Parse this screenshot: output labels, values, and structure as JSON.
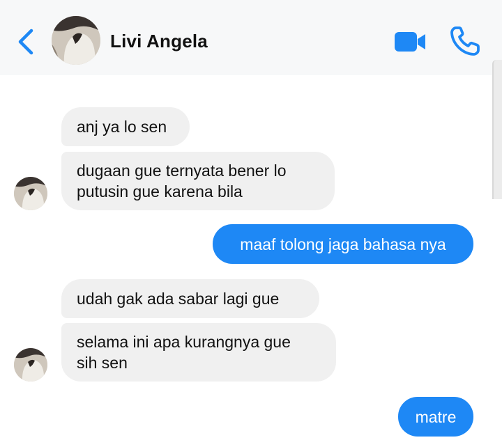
{
  "header": {
    "contact_name": "Livi Angela",
    "back_icon": "chevron-left-icon",
    "video_icon": "video-camera-icon",
    "call_icon": "phone-icon",
    "accent_color": "#1e88f5"
  },
  "messages": [
    {
      "from": "contact",
      "text": "anj ya lo sen"
    },
    {
      "from": "contact",
      "text": "dugaan gue ternyata bener lo\nputusin gue karena bila"
    },
    {
      "from": "me",
      "text": "maaf tolong jaga bahasa nya"
    },
    {
      "from": "contact",
      "text": "udah gak ada sabar lagi gue"
    },
    {
      "from": "contact",
      "text": "selama ini apa kurangnya gue\nsih sen"
    },
    {
      "from": "me",
      "text": "matre"
    }
  ]
}
